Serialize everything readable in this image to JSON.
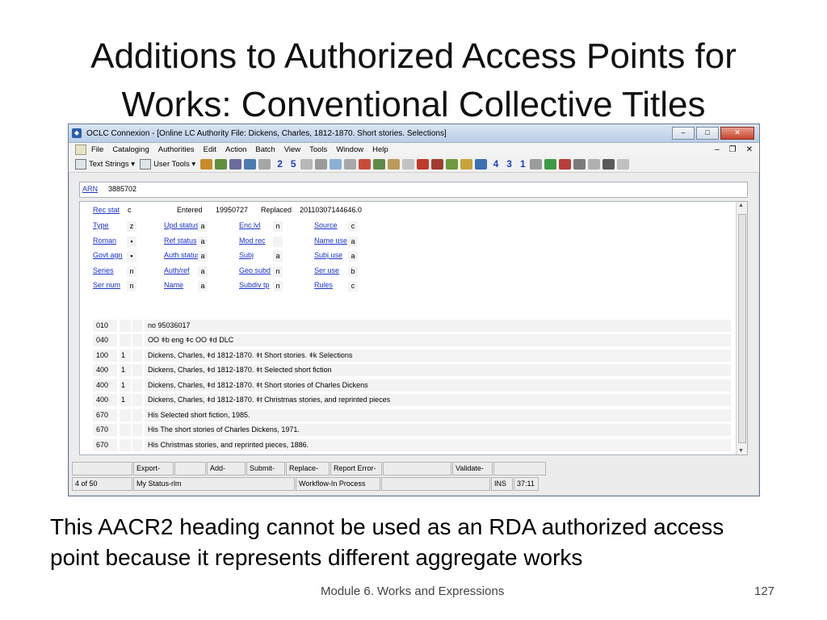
{
  "slide": {
    "title_line1": "Additions to Authorized Access Points for",
    "title_line2": "Works: Conventional Collective Titles",
    "caption_line1": "This AACR2 heading cannot be used as an RDA authorized access",
    "caption_line2": "point because it represents different aggregate works",
    "footer_module": "Module 6. Works and Expressions",
    "footer_page": "127"
  },
  "window": {
    "title": "OCLC Connexion - [Online LC Authority File: Dickens, Charles, 1812-1870. Short stories. Selections]",
    "menu": [
      "File",
      "Cataloging",
      "Authorities",
      "Edit",
      "Action",
      "Batch",
      "View",
      "Tools",
      "Window",
      "Help"
    ],
    "toolbar": {
      "text_strings": "Text Strings",
      "user_tools": "User Tools",
      "numbers_left": [
        "2",
        "5"
      ],
      "numbers_right": [
        "4",
        "3",
        "1"
      ]
    }
  },
  "record": {
    "arn_label": "ARN",
    "arn_value": "3885702",
    "header": {
      "rec_stat_label": "Rec stat",
      "rec_stat_value": "c",
      "entered_label": "Entered",
      "entered_value": "19950727",
      "replaced_label": "Replaced",
      "replaced_value": "20110307144646.0"
    },
    "fixed_fields": [
      [
        {
          "label": "Type",
          "value": "z"
        },
        {
          "label": "Upd status",
          "value": "a"
        },
        {
          "label": "Enc lvl",
          "value": "n"
        },
        {
          "label": "Source",
          "value": "c"
        }
      ],
      [
        {
          "label": "Roman",
          "value": "▪"
        },
        {
          "label": "Ref status",
          "value": "a"
        },
        {
          "label": "Mod rec",
          "value": ""
        },
        {
          "label": "Name use",
          "value": "a"
        }
      ],
      [
        {
          "label": "Govt agn",
          "value": "▪"
        },
        {
          "label": "Auth status",
          "value": "a"
        },
        {
          "label": "Subj",
          "value": "a"
        },
        {
          "label": "Subj use",
          "value": "a"
        }
      ],
      [
        {
          "label": "Series",
          "value": "n"
        },
        {
          "label": "Auth/ref",
          "value": "a"
        },
        {
          "label": "Geo subd",
          "value": "n"
        },
        {
          "label": "Ser use",
          "value": "b"
        }
      ],
      [
        {
          "label": "Ser num",
          "value": "n"
        },
        {
          "label": "Name",
          "value": "a"
        },
        {
          "label": "Subdiv tp",
          "value": "n"
        },
        {
          "label": "Rules",
          "value": "c"
        }
      ]
    ],
    "variable_fields": [
      {
        "tag": "010",
        "ind1": "",
        "text": "no 95036017"
      },
      {
        "tag": "040",
        "ind1": "",
        "text": "OO ǂb eng ǂc OO ǂd DLC"
      },
      {
        "tag": "100",
        "ind1": "1",
        "text": "Dickens, Charles, ǂd 1812-1870. ǂt Short stories. ǂk Selections"
      },
      {
        "tag": "400",
        "ind1": "1",
        "text": "Dickens, Charles, ǂd 1812-1870. ǂt Selected short fiction"
      },
      {
        "tag": "400",
        "ind1": "1",
        "text": "Dickens, Charles, ǂd 1812-1870. ǂt Short stories of Charles Dickens"
      },
      {
        "tag": "400",
        "ind1": "1",
        "text": "Dickens, Charles, ǂd 1812-1870. ǂt Christmas stories, and reprinted pieces"
      },
      {
        "tag": "670",
        "ind1": "",
        "text": "His Selected short fiction, 1985."
      },
      {
        "tag": "670",
        "ind1": "",
        "text": "His The short stories of Charles Dickens, 1971."
      },
      {
        "tag": "670",
        "ind1": "",
        "text": "His Christmas stories, and reprinted pieces, 1886."
      }
    ]
  },
  "status": {
    "row1": [
      "Export-",
      "Add-",
      "Submit-",
      "Replace-",
      "Report Error-",
      "Validate-"
    ],
    "record_position": "4 of 50",
    "my_status": "My Status-rlm",
    "workflow": "Workflow-In Process",
    "mode": "INS",
    "cursor": "37:11"
  }
}
